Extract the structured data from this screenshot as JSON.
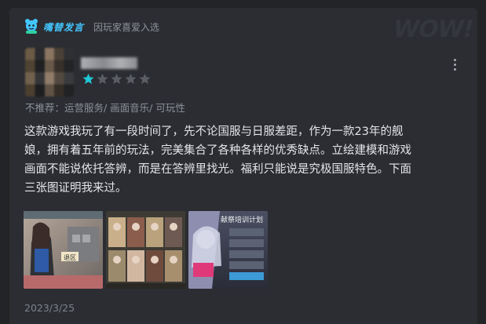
{
  "header": {
    "badge_text": "嘴替发言",
    "badge_subtitle": "因玩家喜爱入选",
    "watermark": "WOW!"
  },
  "review": {
    "rating": 1,
    "rating_max": 5,
    "tags_line": "不推荐：运营服务/ 画面音乐/ 可玩性",
    "body_lines": [
      "这款游戏我玩了有一段时间了，先不论国服与日服差距，作为一款23年的舰",
      "娘，拥有着五年前的玩法，完美集合了各种各样的优秀缺点。立绘建模和游戏",
      "画面不能说依托答辨，而是在答辨里找光。福利只能说是究极国服特色。下面",
      "三张图证明我来过。"
    ],
    "image_labels": [
      "退区",
      "献祭培训计划"
    ],
    "date": "2023/3/25"
  },
  "icons": {
    "badge_logo": "mascot-logo-icon",
    "star_filled": "star-filled-icon",
    "star_empty": "star-empty-icon",
    "more": "more-vertical-icon"
  },
  "colors": {
    "accent": "#43c6ff",
    "star_filled": "#20c7d6",
    "star_empty": "#5a5d63",
    "card_bg": "#2b2d32",
    "page_bg": "#232427"
  }
}
